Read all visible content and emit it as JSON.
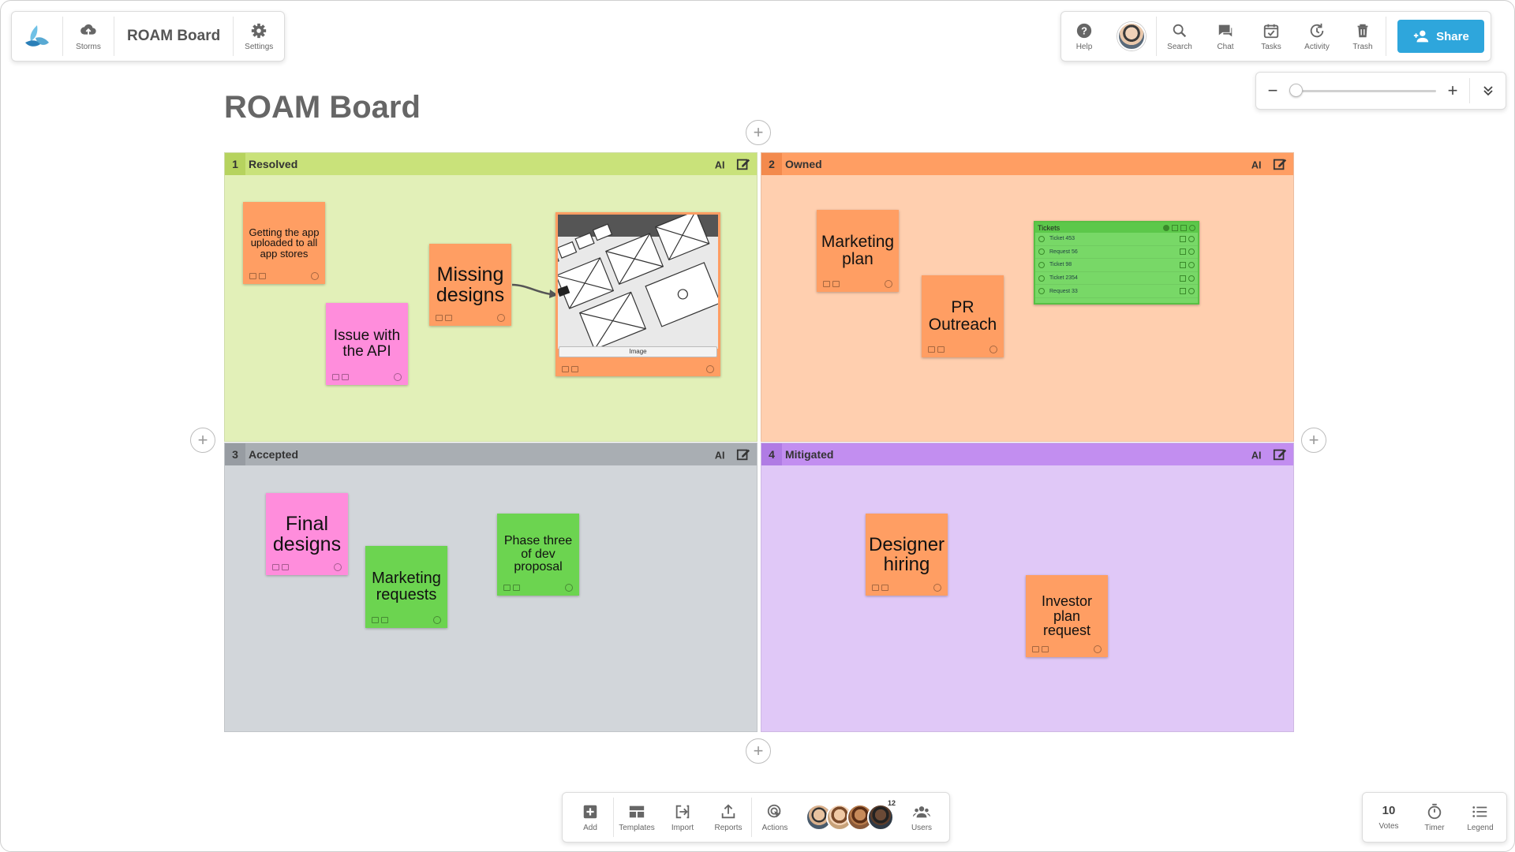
{
  "colors": {
    "brand": "#2ea6dc",
    "resolved_head": "#c9e27a",
    "resolved_body": "#e2f0b8",
    "owned_head": "#ff9e63",
    "owned_body": "#ffcfaf",
    "accepted_head": "#a9aeb3",
    "accepted_body": "#d2d6da",
    "mitigated_head": "#c28ef0",
    "mitigated_body": "#e0c8f7",
    "note_orange": "#ff9e63",
    "note_pink": "#ff8ddc",
    "note_green": "#6cd450"
  },
  "top_left": {
    "storms_label": "Storms",
    "title": "ROAM Board",
    "settings_label": "Settings"
  },
  "top_right": {
    "help": "Help",
    "search": "Search",
    "chat": "Chat",
    "tasks": "Tasks",
    "activity": "Activity",
    "trash": "Trash",
    "share": "Share"
  },
  "zoom": {
    "minus": "−",
    "plus": "+"
  },
  "board": {
    "title": "ROAM Board",
    "add_symbol": "+"
  },
  "quadrants": [
    {
      "num": "1",
      "label": "Resolved"
    },
    {
      "num": "2",
      "label": "Owned"
    },
    {
      "num": "3",
      "label": "Accepted"
    },
    {
      "num": "4",
      "label": "Mitigated"
    }
  ],
  "notes": {
    "app_stores": "Getting the app uploaded to all app stores",
    "issue_api": "Issue with the API",
    "missing_designs": "Missing designs",
    "image_caption": "Image",
    "marketing_plan": "Marketing plan",
    "pr_outreach": "PR Outreach",
    "final_designs": "Final designs",
    "marketing_requests": "Marketing requests",
    "phase_three": "Phase three of dev proposal",
    "designer_hiring": "Designer hiring",
    "investor_plan": "Investor plan request"
  },
  "tickets": {
    "title": "Tickets",
    "rows": [
      "Ticket 453",
      "Request 56",
      "Ticket 98",
      "Ticket 2354",
      "Request 33"
    ]
  },
  "bottom": {
    "add": "Add",
    "templates": "Templates",
    "import": "Import",
    "reports": "Reports",
    "actions": "Actions",
    "user_count": "12",
    "users": "Users"
  },
  "bottom_right": {
    "votes_count": "10",
    "votes": "Votes",
    "timer": "Timer",
    "legend": "Legend"
  }
}
